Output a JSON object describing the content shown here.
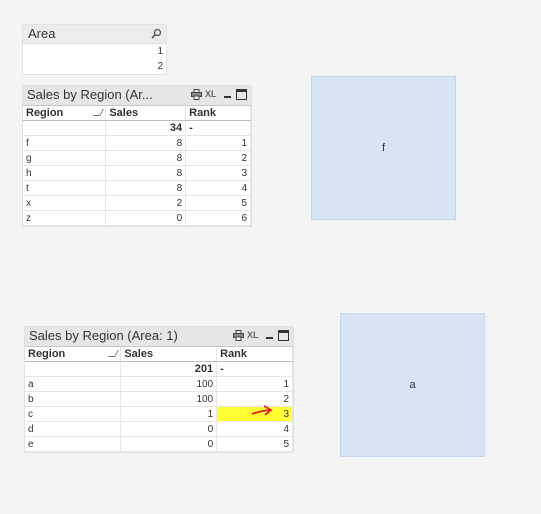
{
  "area_listbox": {
    "title": "Area",
    "values": [
      "1",
      "2"
    ]
  },
  "table1": {
    "title": "Sales by Region (Ar...",
    "xl_label": "XL",
    "headers": [
      "Region",
      "Sales",
      "Rank"
    ],
    "total_sales": "34",
    "total_rank": "-",
    "rows": [
      {
        "region": "f",
        "sales": "8",
        "rank": "1"
      },
      {
        "region": "g",
        "sales": "8",
        "rank": "2"
      },
      {
        "region": "h",
        "sales": "8",
        "rank": "3"
      },
      {
        "region": "t",
        "sales": "8",
        "rank": "4"
      },
      {
        "region": "x",
        "sales": "2",
        "rank": "5"
      },
      {
        "region": "z",
        "sales": "0",
        "rank": "6"
      }
    ]
  },
  "table2": {
    "title": "Sales by Region (Area: 1)",
    "xl_label": "XL",
    "headers": [
      "Region",
      "Sales",
      "Rank"
    ],
    "total_sales": "201",
    "total_rank": "-",
    "rows": [
      {
        "region": "a",
        "sales": "100",
        "rank": "1"
      },
      {
        "region": "b",
        "sales": "100",
        "rank": "2"
      },
      {
        "region": "c",
        "sales": "1",
        "rank": "3"
      },
      {
        "region": "d",
        "sales": "0",
        "rank": "4"
      },
      {
        "region": "e",
        "sales": "0",
        "rank": "5"
      }
    ]
  },
  "text_object_1": {
    "text": "f"
  },
  "text_object_2": {
    "text": "a"
  },
  "colors": {
    "highlight": "#ffff33",
    "annotation_arrow": "#e0201a",
    "text_box_bg": "#d6e4f4"
  }
}
